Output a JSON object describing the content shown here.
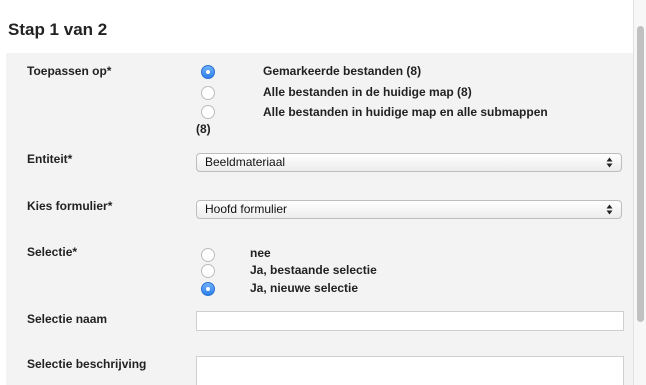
{
  "step_title": "Stap 1 van 2",
  "fields": {
    "toepassen": {
      "label": "Toepassen op*",
      "options": [
        "Gemarkeerde bestanden (8)",
        "Alle bestanden in de huidige map (8)",
        "Alle bestanden in huidige map en alle submappen"
      ],
      "overflow_text": "(8)",
      "selected_index": 0
    },
    "entiteit": {
      "label": "Entiteit*",
      "value": "Beeldmateriaal"
    },
    "formulier": {
      "label": "Kies formulier*",
      "value": "Hoofd formulier"
    },
    "selectie": {
      "label": "Selectie*",
      "options": [
        "nee",
        "Ja, bestaande selectie",
        "Ja, nieuwe selectie"
      ],
      "selected_index": 2
    },
    "selectie_naam": {
      "label": "Selectie naam",
      "value": ""
    },
    "selectie_beschrijving": {
      "label": "Selectie beschrijving",
      "value": ""
    }
  }
}
